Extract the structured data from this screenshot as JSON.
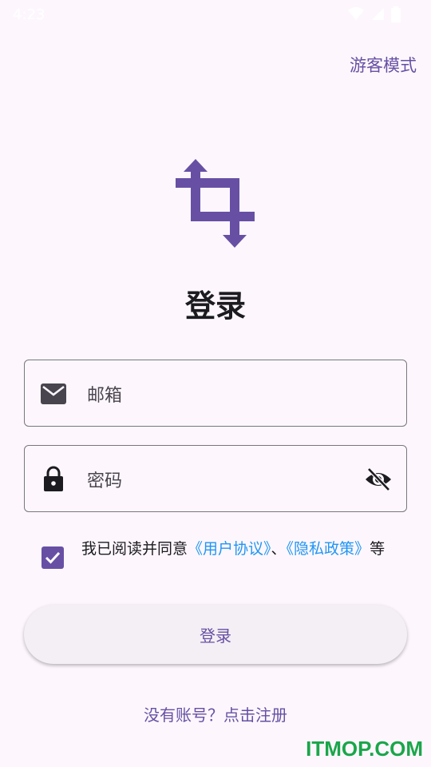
{
  "status_bar": {
    "time": "4:23"
  },
  "header": {
    "guest_mode": "游客模式"
  },
  "main": {
    "title": "登录",
    "email": {
      "placeholder": "邮箱"
    },
    "password": {
      "placeholder": "密码"
    },
    "agreement": {
      "prefix": "我已阅读并同意",
      "user_agreement": "《用户协议》",
      "separator": "、",
      "privacy_policy": "《隐私政策》",
      "suffix": "等",
      "checked": true
    },
    "login_button": "登录",
    "register_link": "没有账号？点击注册"
  },
  "watermark": "ITMOP.COM",
  "colors": {
    "primary": "#6750a4",
    "link": "#2196f3",
    "background": "#fdf7fd"
  }
}
